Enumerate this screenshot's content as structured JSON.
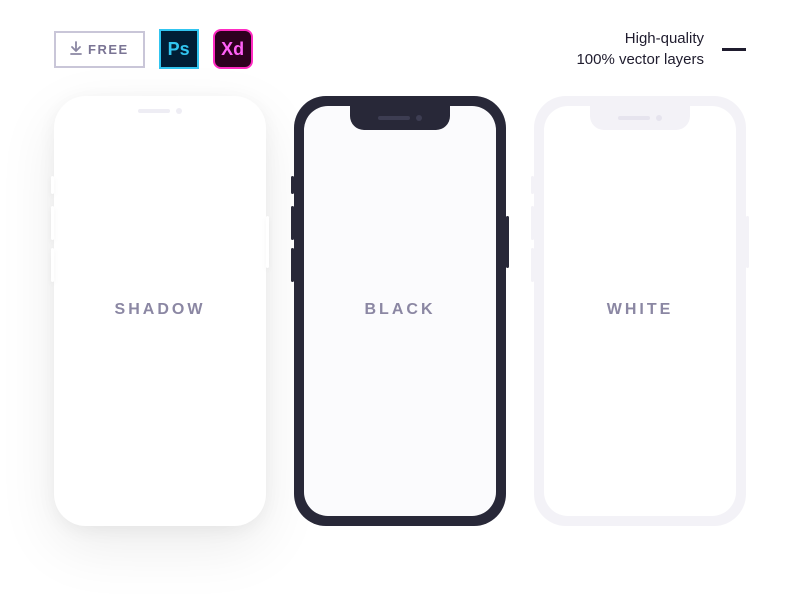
{
  "header": {
    "free_label": "FREE",
    "ps_label": "Ps",
    "xd_label": "Xd",
    "tagline_line1": "High-quality",
    "tagline_line2": "100% vector layers"
  },
  "phones": {
    "shadow_label": "SHADOW",
    "black_label": "BLACK",
    "white_label": "WHITE"
  }
}
